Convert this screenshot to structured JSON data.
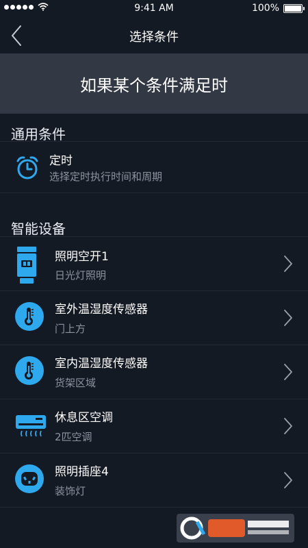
{
  "status": {
    "time": "9:41 AM",
    "battery": "100%",
    "battery_level": 1.0
  },
  "nav": {
    "title": "选择条件",
    "back_icon": "chevron-left-icon"
  },
  "banner": {
    "text": "如果某个条件满足时"
  },
  "sections": [
    {
      "header": "通用条件",
      "items": [
        {
          "title": "定时",
          "subtitle": "选择定时执行时间和周期",
          "icon": "alarm-clock-icon"
        }
      ]
    },
    {
      "header": "智能设备",
      "items": [
        {
          "title": "照明空开1",
          "subtitle": "日光灯照明",
          "icon": "switch-icon"
        },
        {
          "title": "室外温湿度传感器",
          "subtitle": "门上方",
          "icon": "thermometer-icon"
        },
        {
          "title": "室内温湿度传感器",
          "subtitle": "货架区域",
          "icon": "thermometer-icon"
        },
        {
          "title": "休息区空调",
          "subtitle": "2匹空调",
          "icon": "air-conditioner-icon"
        },
        {
          "title": "照明插座4",
          "subtitle": "装饰灯",
          "icon": "socket-icon"
        }
      ]
    }
  ],
  "colors": {
    "background": "#141a24",
    "banner": "#323844",
    "accent": "#2fa9ee",
    "subtitle": "#8c949f"
  }
}
